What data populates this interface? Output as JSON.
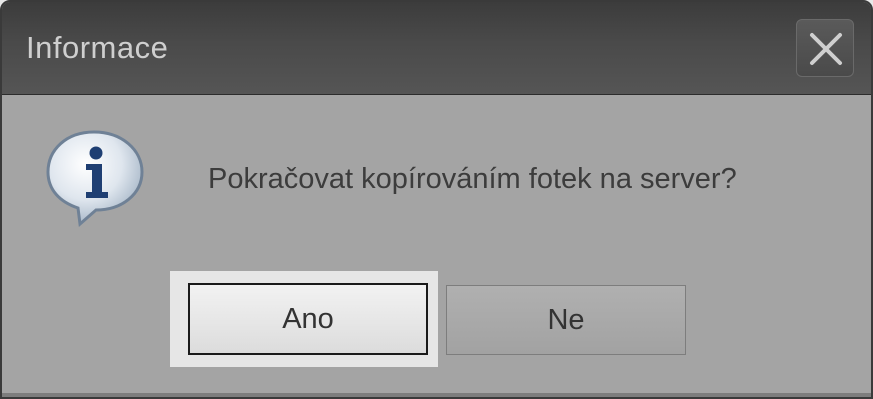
{
  "dialog": {
    "title": "Informace",
    "close_icon": "close-icon",
    "message_icon": "info-icon",
    "message": "Pokračovat kopírováním fotek na server?",
    "buttons": {
      "yes_label": "Ano",
      "no_label": "Ne"
    },
    "colors": {
      "titlebar": "#444444",
      "body": "#a4a4a4",
      "default_button": "#e6e6e6"
    }
  }
}
